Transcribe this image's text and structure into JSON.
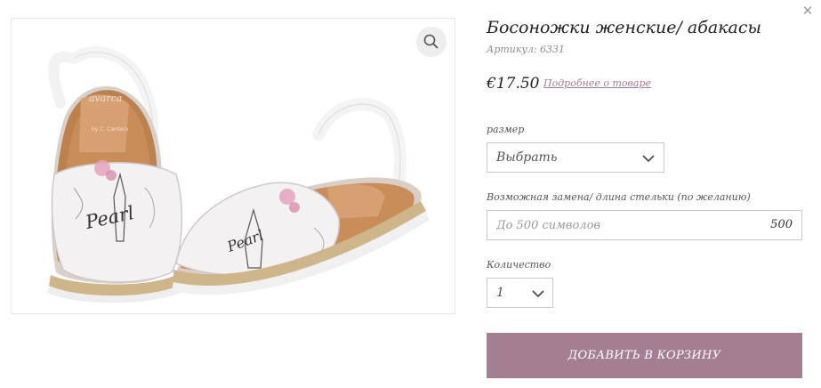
{
  "product": {
    "title": "Босоножки женские/ абакасы",
    "sku": "Артикул: 6331",
    "price": "€17.50",
    "details_link": "Подробнее о товаре",
    "image_alt": "avarca",
    "image_text": [
      "avarca",
      "by C. Cantero",
      "Pearl",
      "Pearl"
    ]
  },
  "form": {
    "size": {
      "label": "размер",
      "selected": "Выбрать"
    },
    "insole": {
      "label": "Возможная замена/ длина стельки (по желанию)",
      "placeholder": "До 500 символов",
      "counter": "500"
    },
    "quantity": {
      "label": "Количество",
      "selected": "1"
    }
  },
  "actions": {
    "add_to_cart": "ДОБАВИТЬ В КОРЗИНУ"
  },
  "icons": {
    "close": "close-icon",
    "zoom": "search-icon",
    "chevron": "chevron-down-icon"
  },
  "colors": {
    "accent": "#a47f92",
    "link": "#a27c93",
    "border": "#c9c9c9"
  }
}
